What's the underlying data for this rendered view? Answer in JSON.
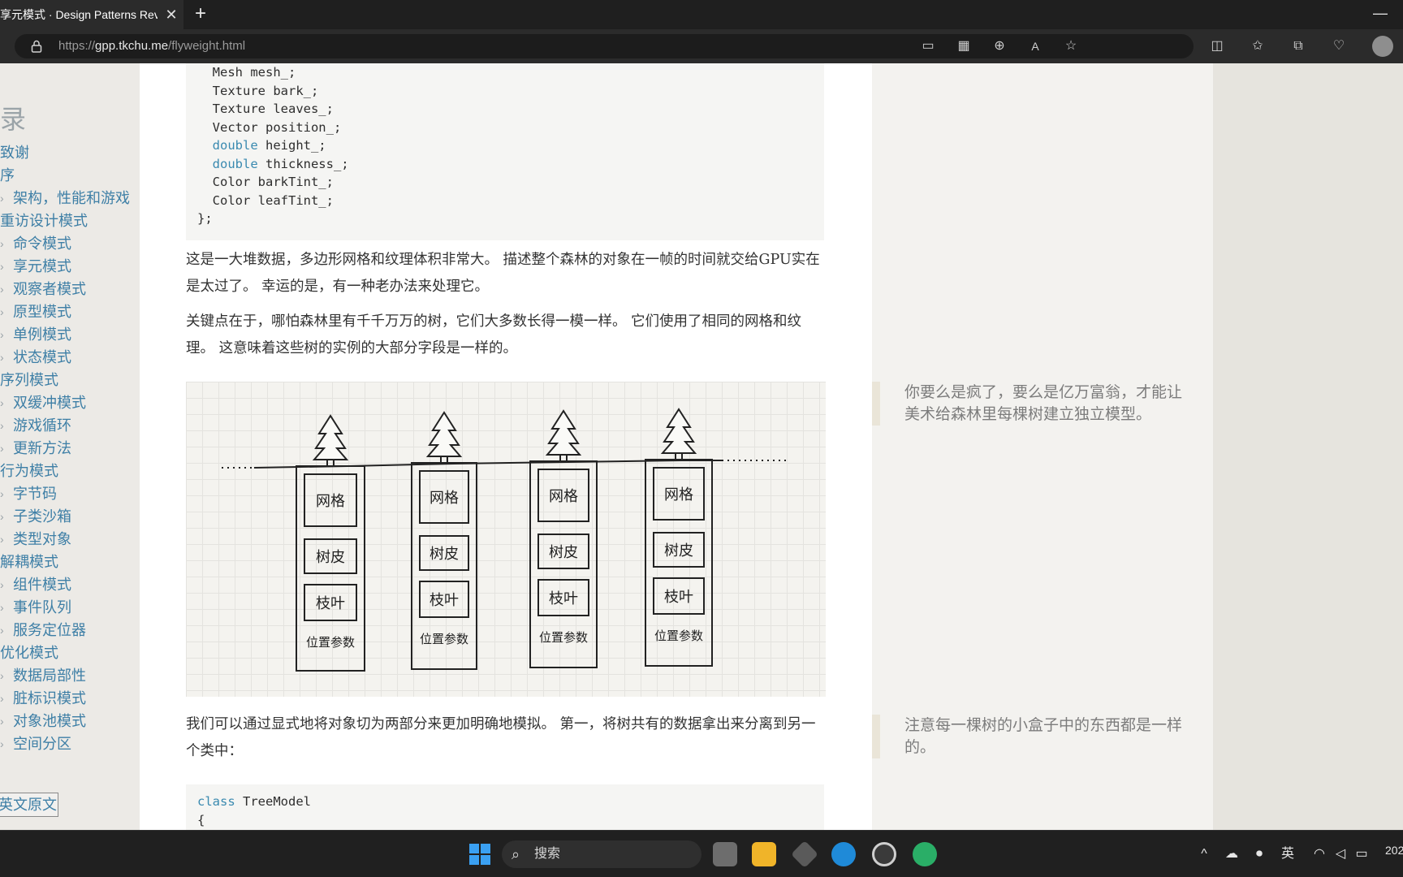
{
  "browser": {
    "tab_title": "享元模式 · Design Patterns Revisi",
    "url_prefix": "https://",
    "url_host": "gpp.tkchu.me",
    "url_path": "/flyweight.html"
  },
  "sidebar": {
    "title": "录",
    "items": [
      {
        "label": "致谢",
        "level": "top"
      },
      {
        "label": "序",
        "level": "top"
      },
      {
        "label": "架构，性能和游戏",
        "level": "sub"
      },
      {
        "label": "重访设计模式",
        "level": "top"
      },
      {
        "label": "命令模式",
        "level": "sub"
      },
      {
        "label": "享元模式",
        "level": "sub"
      },
      {
        "label": "观察者模式",
        "level": "sub"
      },
      {
        "label": "原型模式",
        "level": "sub"
      },
      {
        "label": "单例模式",
        "level": "sub"
      },
      {
        "label": "状态模式",
        "level": "sub"
      },
      {
        "label": "序列模式",
        "level": "top"
      },
      {
        "label": "双缓冲模式",
        "level": "sub"
      },
      {
        "label": "游戏循环",
        "level": "sub"
      },
      {
        "label": "更新方法",
        "level": "sub"
      },
      {
        "label": "行为模式",
        "level": "top"
      },
      {
        "label": "字节码",
        "level": "sub"
      },
      {
        "label": "子类沙箱",
        "level": "sub"
      },
      {
        "label": "类型对象",
        "level": "sub"
      },
      {
        "label": "解耦模式",
        "level": "top"
      },
      {
        "label": "组件模式",
        "level": "sub"
      },
      {
        "label": "事件队列",
        "level": "sub"
      },
      {
        "label": "服务定位器",
        "level": "sub"
      },
      {
        "label": "优化模式",
        "level": "top"
      },
      {
        "label": "数据局部性",
        "level": "sub"
      },
      {
        "label": "脏标识模式",
        "level": "sub"
      },
      {
        "label": "对象池模式",
        "level": "sub"
      },
      {
        "label": "空间分区",
        "level": "sub"
      }
    ],
    "original_button": "英文原文"
  },
  "code_top": {
    "lines": [
      {
        "kw": "",
        "text": "  Mesh mesh_;"
      },
      {
        "kw": "",
        "text": "  Texture bark_;"
      },
      {
        "kw": "",
        "text": "  Texture leaves_;"
      },
      {
        "kw": "",
        "text": "  Vector position_;"
      },
      {
        "kw": "  double",
        "text": " height_;"
      },
      {
        "kw": "  double",
        "text": " thickness_;"
      },
      {
        "kw": "",
        "text": "  Color barkTint_;"
      },
      {
        "kw": "",
        "text": "  Color leafTint_;"
      },
      {
        "kw": "",
        "text": "};"
      }
    ]
  },
  "paragraphs": {
    "p1": "这是一大堆数据，多边形网格和纹理体积非常大。 描述整个森林的对象在一帧的时间就交给GPU实在是太过了。 幸运的是，有一种老办法来处理它。",
    "p2": "关键点在于，哪怕森林里有千千万万的树，它们大多数长得一模一样。 它们使用了相同的网格和纹理。 这意味着这些树的实例的大部分字段是一样的。",
    "p3": "我们可以通过显式地将对象切为两部分来更加明确地模拟。 第一，将树共有的数据拿出来分离到另一个类中："
  },
  "figure": {
    "box_labels": [
      "网格",
      "树皮",
      "枝叶",
      "位置参数"
    ]
  },
  "code_bottom": {
    "keyword": "class",
    "name": " TreeModel",
    "brace": "{"
  },
  "asides": {
    "a1": "你要么是疯了，要么是亿万富翁，才能让美术给森林里每棵树建立独立模型。",
    "a2": "注意每一棵树的小盒子中的东西都是一样的。"
  },
  "taskbar": {
    "search_label": "搜索",
    "ime": "英",
    "clock": "202"
  },
  "colors": {
    "link": "#3e7fa6",
    "keyword": "#3a8ab0",
    "taskbar": "#202020"
  }
}
